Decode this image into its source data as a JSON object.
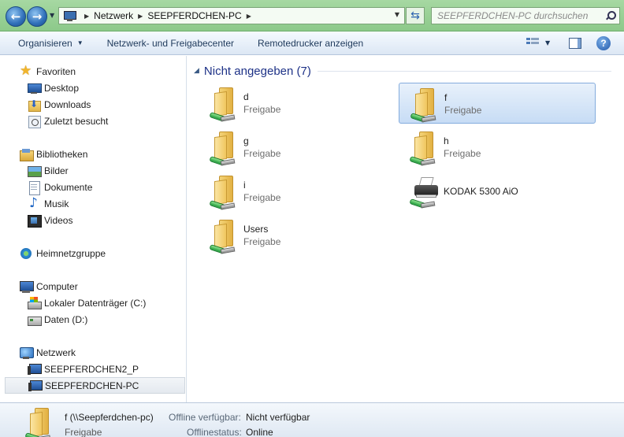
{
  "address_bar": {
    "breadcrumbs": [
      "Netzwerk",
      "SEEPFERDCHEN-PC"
    ],
    "search_placeholder": "SEEPFERDCHEN-PC durchsuchen"
  },
  "toolbar": {
    "organize_label": "Organisieren",
    "network_center_label": "Netzwerk- und Freigabecenter",
    "remote_printers_label": "Remotedrucker anzeigen"
  },
  "sidebar": {
    "favorites": {
      "label": "Favoriten",
      "items": [
        {
          "label": "Desktop",
          "icon": "desktop-icon"
        },
        {
          "label": "Downloads",
          "icon": "downloads-icon"
        },
        {
          "label": "Zuletzt besucht",
          "icon": "recent-places-icon"
        }
      ]
    },
    "libraries": {
      "label": "Bibliotheken",
      "items": [
        {
          "label": "Bilder",
          "icon": "pictures-icon"
        },
        {
          "label": "Dokumente",
          "icon": "documents-icon"
        },
        {
          "label": "Musik",
          "icon": "music-icon"
        },
        {
          "label": "Videos",
          "icon": "videos-icon"
        }
      ]
    },
    "homegroup": {
      "label": "Heimnetzgruppe"
    },
    "computer": {
      "label": "Computer",
      "items": [
        {
          "label": "Lokaler Datenträger (C:)",
          "icon": "system-drive-icon"
        },
        {
          "label": "Daten (D:)",
          "icon": "drive-icon"
        }
      ]
    },
    "network": {
      "label": "Netzwerk",
      "items": [
        {
          "label": "SEEPFERDCHEN2_P",
          "icon": "network-computer-icon",
          "selected": false
        },
        {
          "label": "SEEPFERDCHEN-PC",
          "icon": "network-computer-icon",
          "selected": true
        }
      ]
    }
  },
  "main": {
    "group_title": "Nicht angegeben (7)",
    "items": [
      {
        "name": "d",
        "type": "Freigabe",
        "icon": "shared-folder-icon",
        "selected": false
      },
      {
        "name": "f",
        "type": "Freigabe",
        "icon": "shared-folder-icon",
        "selected": true
      },
      {
        "name": "g",
        "type": "Freigabe",
        "icon": "shared-folder-icon",
        "selected": false
      },
      {
        "name": "h",
        "type": "Freigabe",
        "icon": "shared-folder-icon",
        "selected": false
      },
      {
        "name": "i",
        "type": "Freigabe",
        "icon": "shared-folder-icon",
        "selected": false
      },
      {
        "name": "KODAK 5300 AiO",
        "type": "",
        "icon": "network-printer-icon",
        "selected": false
      },
      {
        "name": "Users",
        "type": "Freigabe",
        "icon": "shared-folder-icon",
        "selected": false
      }
    ]
  },
  "details": {
    "name": "f (\\\\Seepferdchen-pc)",
    "type": "Freigabe",
    "offline_available_label": "Offline verfügbar:",
    "offline_available_value": "Nicht verfügbar",
    "offline_status_label": "Offlinestatus:",
    "offline_status_value": "Online"
  }
}
